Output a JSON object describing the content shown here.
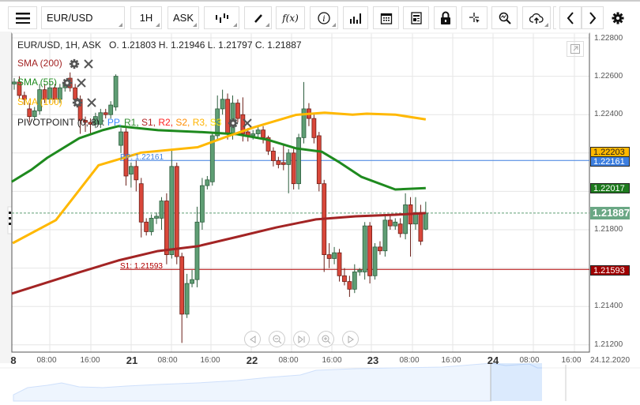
{
  "toolbar": {
    "symbol": "EUR/USD",
    "interval": "1H",
    "price_type": "ASK",
    "fx_label": "f(x)"
  },
  "legend": {
    "header": "EUR/USD, 1H, ASK",
    "ohlc": "O. 1.21803 H. 1.21946 L. 1.21797 C. 1.21887",
    "sma200": "SMA (200)",
    "sma55": "SMA (55)",
    "sma100": "SMA (100)",
    "pivot": "PIVOTPOINT (0, 8)",
    "pivot_sep": ":",
    "pivot_items": [
      {
        "t": "PP,",
        "c": "#3d8bff"
      },
      {
        "t": "R1,",
        "c": "#2e8b2e"
      },
      {
        "t": "S1,",
        "c": "#b22222"
      },
      {
        "t": "R2,",
        "c": "#ff2020"
      },
      {
        "t": "S2,",
        "c": "#ff8c00"
      },
      {
        "t": "R3,",
        "c": "#ffb300"
      },
      {
        "t": "S3",
        "c": "#ffe000"
      }
    ]
  },
  "pivot_labels": {
    "pp": "PP: 1.22161",
    "s1": "S1: 1.21593"
  },
  "price_axis": [
    "1.22800",
    "1.22600",
    "1.22400",
    "1.22200",
    "1.21800",
    "1.21400",
    "1.21200"
  ],
  "price_tags": {
    "sma100": "1.22203",
    "pp": "1.22161",
    "sma55": "1.22017",
    "last": "1.21887",
    "s1": "1.21593"
  },
  "time_axis": [
    "8",
    "08:00",
    "16:00",
    "21",
    "08:00",
    "16:00",
    "22",
    "08:00",
    "16:00",
    "23",
    "08:00",
    "16:00",
    "24",
    "08:00",
    "16:00"
  ],
  "date_label": "24.12.2020",
  "colors": {
    "up": "#5f9e74",
    "down": "#d9473a",
    "sma55": "#1e8a1e",
    "sma100": "#ffb800",
    "sma200": "#a32424",
    "pp": "#3d7fe0",
    "s1": "#b00000"
  },
  "chart_data": {
    "type": "candlestick",
    "ylim": [
      1.2112,
      1.229
    ],
    "levels": {
      "pp": 1.22161,
      "s1": 1.21593,
      "last": 1.21887
    },
    "candles": [
      [
        1.2256,
        1.2259,
        1.2253,
        1.2257
      ],
      [
        1.2257,
        1.226,
        1.2248,
        1.225
      ],
      [
        1.225,
        1.2252,
        1.2245,
        1.2248
      ],
      [
        1.2243,
        1.2246,
        1.2236,
        1.2239
      ],
      [
        1.2239,
        1.2244,
        1.2237,
        1.2242
      ],
      [
        1.2242,
        1.2256,
        1.224,
        1.2253
      ],
      [
        1.2253,
        1.2256,
        1.2246,
        1.2248
      ],
      [
        1.2248,
        1.2257,
        1.2246,
        1.2254
      ],
      [
        1.2254,
        1.2256,
        1.2246,
        1.2248
      ],
      [
        1.2248,
        1.2256,
        1.2246,
        1.2254
      ],
      [
        1.2254,
        1.2258,
        1.2252,
        1.2256
      ],
      [
        1.2259,
        1.2262,
        1.2252,
        1.2254
      ],
      [
        1.2254,
        1.2256,
        1.2246,
        1.2248
      ],
      [
        1.2248,
        1.225,
        1.223,
        1.2237
      ],
      [
        1.2237,
        1.2239,
        1.2231,
        1.2236
      ],
      [
        1.2236,
        1.2238,
        1.223,
        1.2235
      ],
      [
        1.2235,
        1.2241,
        1.2233,
        1.2239
      ],
      [
        1.2235,
        1.2243,
        1.2233,
        1.2241
      ],
      [
        1.2241,
        1.2243,
        1.2238,
        1.224
      ],
      [
        1.224,
        1.2247,
        1.2238,
        1.2245
      ],
      [
        1.2244,
        1.2261,
        1.2242,
        1.226
      ],
      [
        1.2224,
        1.2233,
        1.222,
        1.2231
      ],
      [
        1.2231,
        1.2233,
        1.2203,
        1.2208
      ],
      [
        1.2209,
        1.2215,
        1.2202,
        1.2213
      ],
      [
        1.2213,
        1.2216,
        1.22,
        1.2206
      ],
      [
        1.2204,
        1.2207,
        1.2176,
        1.2184
      ],
      [
        1.2184,
        1.2186,
        1.2177,
        1.2179
      ],
      [
        1.2179,
        1.2188,
        1.2177,
        1.2186
      ],
      [
        1.2186,
        1.2189,
        1.2183,
        1.2187
      ],
      [
        1.2186,
        1.2197,
        1.218,
        1.2195
      ],
      [
        1.2195,
        1.2199,
        1.2162,
        1.2167
      ],
      [
        1.2167,
        1.2222,
        1.2165,
        1.2213
      ],
      [
        1.2213,
        1.2215,
        1.2162,
        1.2166
      ],
      [
        1.2166,
        1.2168,
        1.2121,
        1.2136
      ],
      [
        1.2136,
        1.2157,
        1.2134,
        1.2152
      ],
      [
        1.2152,
        1.2159,
        1.215,
        1.2154
      ],
      [
        1.2154,
        1.2192,
        1.215,
        1.2184
      ],
      [
        1.2184,
        1.2207,
        1.218,
        1.2203
      ],
      [
        1.2203,
        1.2208,
        1.2201,
        1.2206
      ],
      [
        1.2205,
        1.2231,
        1.2203,
        1.2229
      ],
      [
        1.2229,
        1.225,
        1.2227,
        1.2243
      ],
      [
        1.2243,
        1.2253,
        1.224,
        1.2248
      ],
      [
        1.2248,
        1.2251,
        1.2227,
        1.223
      ],
      [
        1.223,
        1.225,
        1.2227,
        1.2246
      ],
      [
        1.2246,
        1.2248,
        1.2236,
        1.2238
      ],
      [
        1.224,
        1.2249,
        1.2226,
        1.223
      ],
      [
        1.2231,
        1.2233,
        1.2226,
        1.2229
      ],
      [
        1.2229,
        1.2232,
        1.2227,
        1.223
      ],
      [
        1.223,
        1.2234,
        1.2228,
        1.2232
      ],
      [
        1.2232,
        1.2234,
        1.2225,
        1.2228
      ],
      [
        1.2228,
        1.2229,
        1.2219,
        1.2221
      ],
      [
        1.2221,
        1.2223,
        1.2213,
        1.2216
      ],
      [
        1.2216,
        1.2218,
        1.2212,
        1.2214
      ],
      [
        1.2215,
        1.2225,
        1.2211,
        1.2214
      ],
      [
        1.2214,
        1.2222,
        1.2199,
        1.222
      ],
      [
        1.222,
        1.2223,
        1.2201,
        1.2204
      ],
      [
        1.2204,
        1.223,
        1.2201,
        1.2228
      ],
      [
        1.2228,
        1.2257,
        1.2225,
        1.2243
      ],
      [
        1.2243,
        1.2246,
        1.2234,
        1.2238
      ],
      [
        1.2238,
        1.224,
        1.2225,
        1.2228
      ],
      [
        1.2229,
        1.2231,
        1.22,
        1.2204
      ],
      [
        1.2204,
        1.2206,
        1.2158,
        1.2167
      ],
      [
        1.2167,
        1.2173,
        1.216,
        1.2165
      ],
      [
        1.2165,
        1.2171,
        1.2162,
        1.2168
      ],
      [
        1.2168,
        1.217,
        1.2153,
        1.2156
      ],
      [
        1.2156,
        1.216,
        1.2151,
        1.2153
      ],
      [
        1.2153,
        1.2156,
        1.2145,
        1.2149
      ],
      [
        1.2149,
        1.2162,
        1.2147,
        1.2158
      ],
      [
        1.2158,
        1.216,
        1.2156,
        1.2159
      ],
      [
        1.2158,
        1.2184,
        1.2154,
        1.2182
      ],
      [
        1.2182,
        1.2184,
        1.2152,
        1.2156
      ],
      [
        1.2156,
        1.2173,
        1.2154,
        1.2171
      ],
      [
        1.2171,
        1.2174,
        1.2167,
        1.2169
      ],
      [
        1.2169,
        1.2187,
        1.2166,
        1.2185
      ],
      [
        1.2185,
        1.2188,
        1.218,
        1.2182
      ],
      [
        1.2182,
        1.2186,
        1.218,
        1.2184
      ],
      [
        1.2183,
        1.2186,
        1.2176,
        1.2178
      ],
      [
        1.2178,
        1.2199,
        1.2175,
        1.2193
      ],
      [
        1.2193,
        1.2197,
        1.2166,
        1.2183
      ],
      [
        1.2183,
        1.2197,
        1.218,
        1.2189
      ],
      [
        1.2189,
        1.2193,
        1.2172,
        1.2174
      ],
      [
        1.21803,
        1.21946,
        1.21797,
        1.21887
      ]
    ],
    "series": [
      {
        "name": "SMA (55)",
        "points": [
          [
            -0.5,
            1.2205
          ],
          [
            3.4,
            1.22113
          ],
          [
            6.5,
            1.22175
          ],
          [
            12.8,
            1.22277
          ],
          [
            17.4,
            1.22319
          ],
          [
            20.5,
            1.2234
          ],
          [
            28.3,
            1.22319
          ],
          [
            36.1,
            1.2231
          ],
          [
            43.9,
            1.22298
          ],
          [
            49.9,
            1.22269
          ],
          [
            55.5,
            1.22224
          ],
          [
            60.5,
            1.22207
          ],
          [
            64.1,
            1.2215
          ],
          [
            68.3,
            1.22076
          ],
          [
            75,
            1.2201
          ],
          [
            81,
            1.22017
          ]
        ]
      },
      {
        "name": "SMA (100)",
        "points": [
          [
            -0.3,
            1.2173
          ],
          [
            8.2,
            1.2185
          ],
          [
            16.6,
            1.22136
          ],
          [
            25,
            1.22202
          ],
          [
            36.1,
            1.2223
          ],
          [
            41.7,
            1.22284
          ],
          [
            47.1,
            1.22333
          ],
          [
            55.5,
            1.22399
          ],
          [
            61.1,
            1.2241
          ],
          [
            66.6,
            1.224
          ],
          [
            69.4,
            1.22405
          ],
          [
            75,
            1.224
          ],
          [
            81,
            1.22375
          ]
        ]
      },
      {
        "name": "SMA (200)",
        "points": [
          [
            -0.5,
            1.21467
          ],
          [
            12.8,
            1.21578
          ],
          [
            20.5,
            1.2164
          ],
          [
            28.3,
            1.21689
          ],
          [
            36.1,
            1.21714
          ],
          [
            43.9,
            1.21763
          ],
          [
            51.6,
            1.21812
          ],
          [
            59.4,
            1.21854
          ],
          [
            67.2,
            1.2187
          ],
          [
            75,
            1.21878
          ],
          [
            81,
            1.21887
          ]
        ]
      }
    ]
  }
}
